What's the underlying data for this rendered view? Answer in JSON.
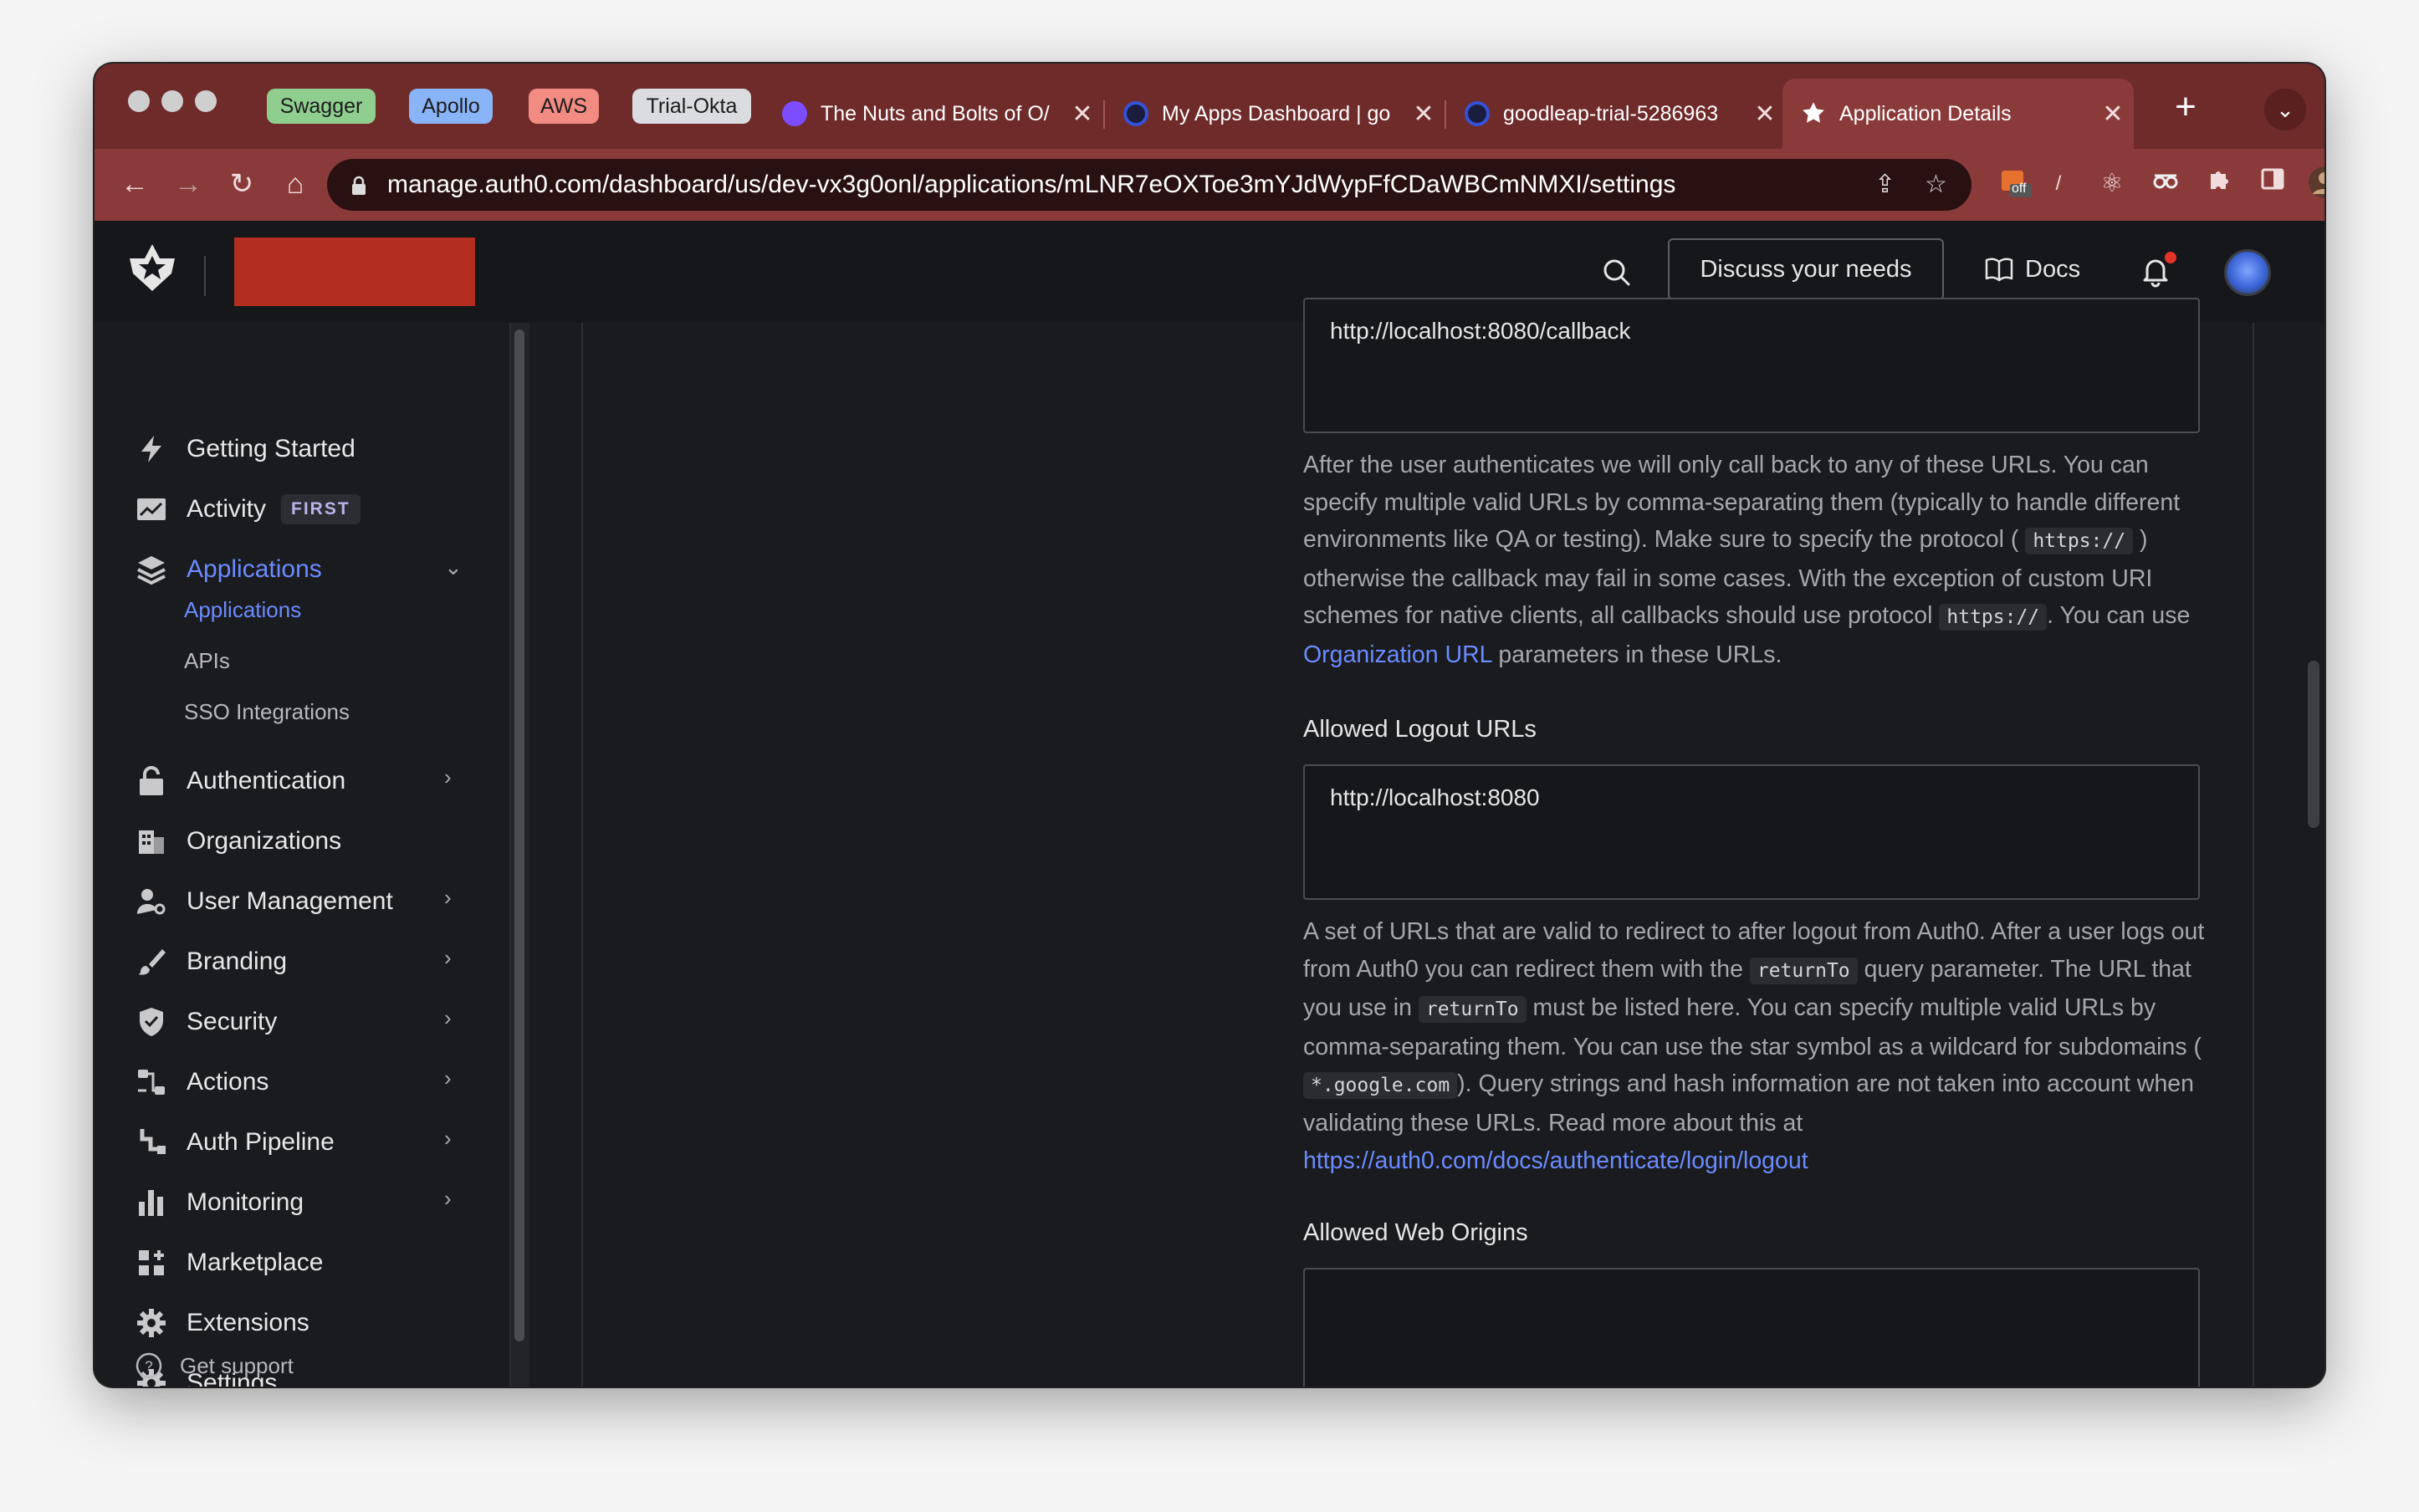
{
  "browser": {
    "tab_groups": [
      {
        "label": "Swagger",
        "color": "#8fce8f"
      },
      {
        "label": "Apollo",
        "color": "#8ab4f8"
      },
      {
        "label": "AWS",
        "color": "#f28b82"
      },
      {
        "label": "Trial-Okta",
        "color": "#dadce0"
      }
    ],
    "tabs": [
      {
        "title": "The Nuts and Bolts of O/",
        "icon": "oauth-favicon-icon"
      },
      {
        "title": "My Apps Dashboard | go",
        "icon": "okta-favicon-icon"
      },
      {
        "title": "goodleap-trial-5286963",
        "icon": "okta-favicon-icon"
      },
      {
        "title": "Application Details",
        "icon": "auth0-favicon-icon"
      }
    ],
    "new_tab": "+",
    "tab_menu": "⌄",
    "url": "manage.auth0.com/dashboard/us/dev-vx3g0onl/applications/mLNR7eOXToe3mYJdWypFfCDaWBCmNMXI/settings",
    "extension_badge": "off"
  },
  "header": {
    "discuss_label": "Discuss your needs",
    "docs_label": "Docs"
  },
  "sidebar": {
    "items": [
      {
        "label": "Getting Started",
        "icon": "lightning-icon"
      },
      {
        "label": "Activity",
        "icon": "activity-chart-icon",
        "badge": "FIRST"
      },
      {
        "label": "Applications",
        "icon": "layers-icon",
        "active": true
      },
      {
        "label": "Authentication",
        "icon": "lock-icon"
      },
      {
        "label": "Organizations",
        "icon": "building-icon"
      },
      {
        "label": "User Management",
        "icon": "user-gear-icon"
      },
      {
        "label": "Branding",
        "icon": "brush-icon"
      },
      {
        "label": "Security",
        "icon": "shield-icon"
      },
      {
        "label": "Actions",
        "icon": "flow-icon"
      },
      {
        "label": "Auth Pipeline",
        "icon": "pipeline-icon"
      },
      {
        "label": "Monitoring",
        "icon": "bar-chart-icon"
      },
      {
        "label": "Marketplace",
        "icon": "grid-plus-icon"
      },
      {
        "label": "Extensions",
        "icon": "gear-icon"
      },
      {
        "label": "Settings",
        "icon": "settings-icon"
      }
    ],
    "sub_items": [
      "Applications",
      "APIs",
      "SSO Integrations"
    ],
    "support_label": "Get support"
  },
  "main": {
    "callback_value": "http://localhost:8080/callback",
    "callback_help": {
      "p1": "After the user authenticates we will only call back to any of these URLs. You can specify multiple valid URLs by comma-separating them (typically to handle different environments like QA or testing). Make sure to specify the protocol (",
      "code1": "https://",
      "p2": ") otherwise the callback may fail in some cases. With the exception of custom URI schemes for native clients, all callbacks should use protocol",
      "code2": "https://",
      "p3": ". You can use",
      "link": "Organization URL",
      "p4": "parameters in these URLs."
    },
    "logout_label": "Allowed Logout URLs",
    "logout_value": "http://localhost:8080",
    "logout_help": {
      "p1": "A set of URLs that are valid to redirect to after logout from Auth0. After a user logs out from Auth0 you can redirect them with the",
      "code1": "returnTo",
      "p2": "query parameter. The URL that you use in",
      "code2": "returnTo",
      "p3": "must be listed here. You can specify multiple valid URLs by comma-separating them. You can use the star symbol as a wildcard for subdomains (",
      "code3": "*.google.com",
      "p4": "). Query strings and hash information are not taken into account when validating these URLs. Read more about this at",
      "link": "https://auth0.com/docs/authenticate/login/logout"
    },
    "web_origins_label": "Allowed Web Origins",
    "web_origins_value": ""
  }
}
